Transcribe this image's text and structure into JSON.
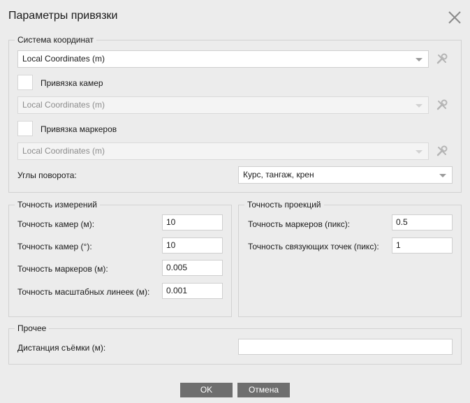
{
  "dialog": {
    "title": "Параметры привязки"
  },
  "coordinate_system": {
    "legend": "Система координат",
    "main_select": "Local Coordinates (m)",
    "camera_ref": {
      "label": "Привязка камер",
      "checked": false,
      "select": "Local Coordinates (m)"
    },
    "marker_ref": {
      "label": "Привязка маркеров",
      "checked": false,
      "select": "Local Coordinates (m)"
    },
    "rotation_angles": {
      "label": "Углы поворота:",
      "value": "Курс, тангаж, крен"
    }
  },
  "measurement_accuracy": {
    "legend": "Точность измерений",
    "rows": [
      {
        "label": "Точность камер (м):",
        "value": "10"
      },
      {
        "label": "Точность камер (°):",
        "value": "10"
      },
      {
        "label": "Точность маркеров (м):",
        "value": "0.005"
      },
      {
        "label": "Точность масштабных линеек (м):",
        "value": "0.001"
      }
    ]
  },
  "projection_accuracy": {
    "legend": "Точность проекций",
    "rows": [
      {
        "label": "Точность маркеров (пикс):",
        "value": "0.5"
      },
      {
        "label": "Точность связующих точек (пикс):",
        "value": "1"
      }
    ]
  },
  "misc": {
    "legend": "Прочее",
    "capture_distance": {
      "label": "Дистанция съёмки (м):",
      "value": ""
    }
  },
  "buttons": {
    "ok": "OK",
    "cancel": "Отмена"
  },
  "colors": {
    "background": "#ececec",
    "button": "#6e6e6e"
  }
}
